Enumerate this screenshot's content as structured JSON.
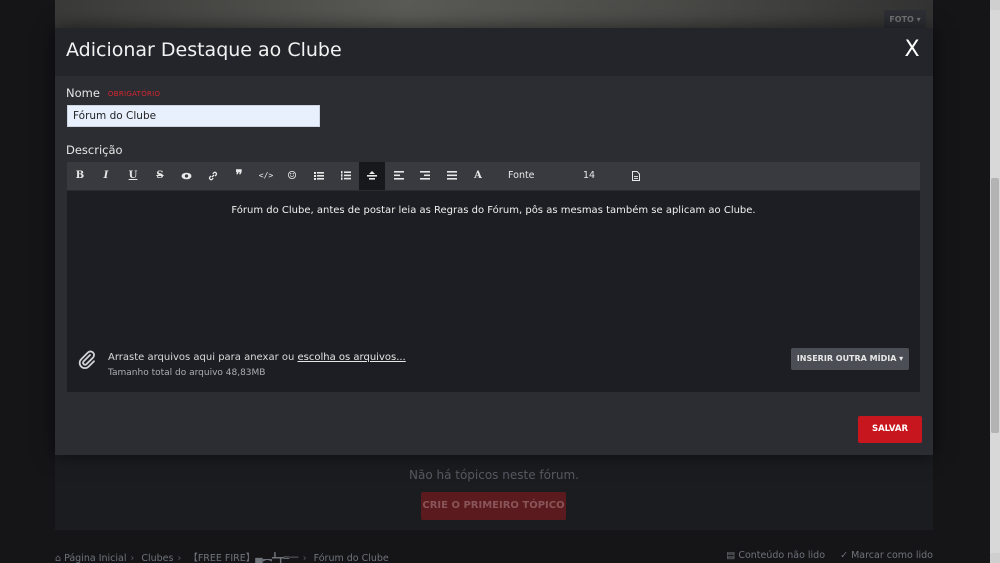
{
  "background": {
    "foto_button": "FOTO ▾",
    "empty_message": "Não há tópicos neste fórum.",
    "create_topic_button": "CRIE O PRIMEIRO TÓPICO",
    "breadcrumb": [
      "Página Inicial",
      "Clubes",
      "【FREE FIRE】▄︻┻┳═一",
      "Fórum do Clube"
    ],
    "unread_content": "Conteúdo não lido",
    "mark_read": "Marcar como lido"
  },
  "modal": {
    "title": "Adicionar Destaque ao Clube",
    "close": "X",
    "name_label": "Nome",
    "required_label": "OBRIGATÓRIO",
    "name_value": "Fórum do Clube",
    "description_label": "Descrição",
    "toolbar": {
      "bold": "B",
      "italic": "I",
      "underline": "U",
      "strike": "S",
      "font_color": "A",
      "font": "Fonte",
      "size": "14"
    },
    "editor_content": "Fórum do Clube, antes de postar leia as Regras do Fórum, pôs as mesmas também se aplicam ao Clube.",
    "attach_text": "Arraste arquivos aqui para anexar ou ",
    "attach_link": "escolha os arquivos...",
    "attach_size": "Tamanho total do arquivo 48,83MB",
    "insert_media": "INSERIR OUTRA MÍDIA ▾",
    "save": "SALVAR"
  },
  "colors": {
    "accent": "#c8161e",
    "modal_bg": "#2b2d33",
    "editor_bg": "#1d1e23"
  }
}
